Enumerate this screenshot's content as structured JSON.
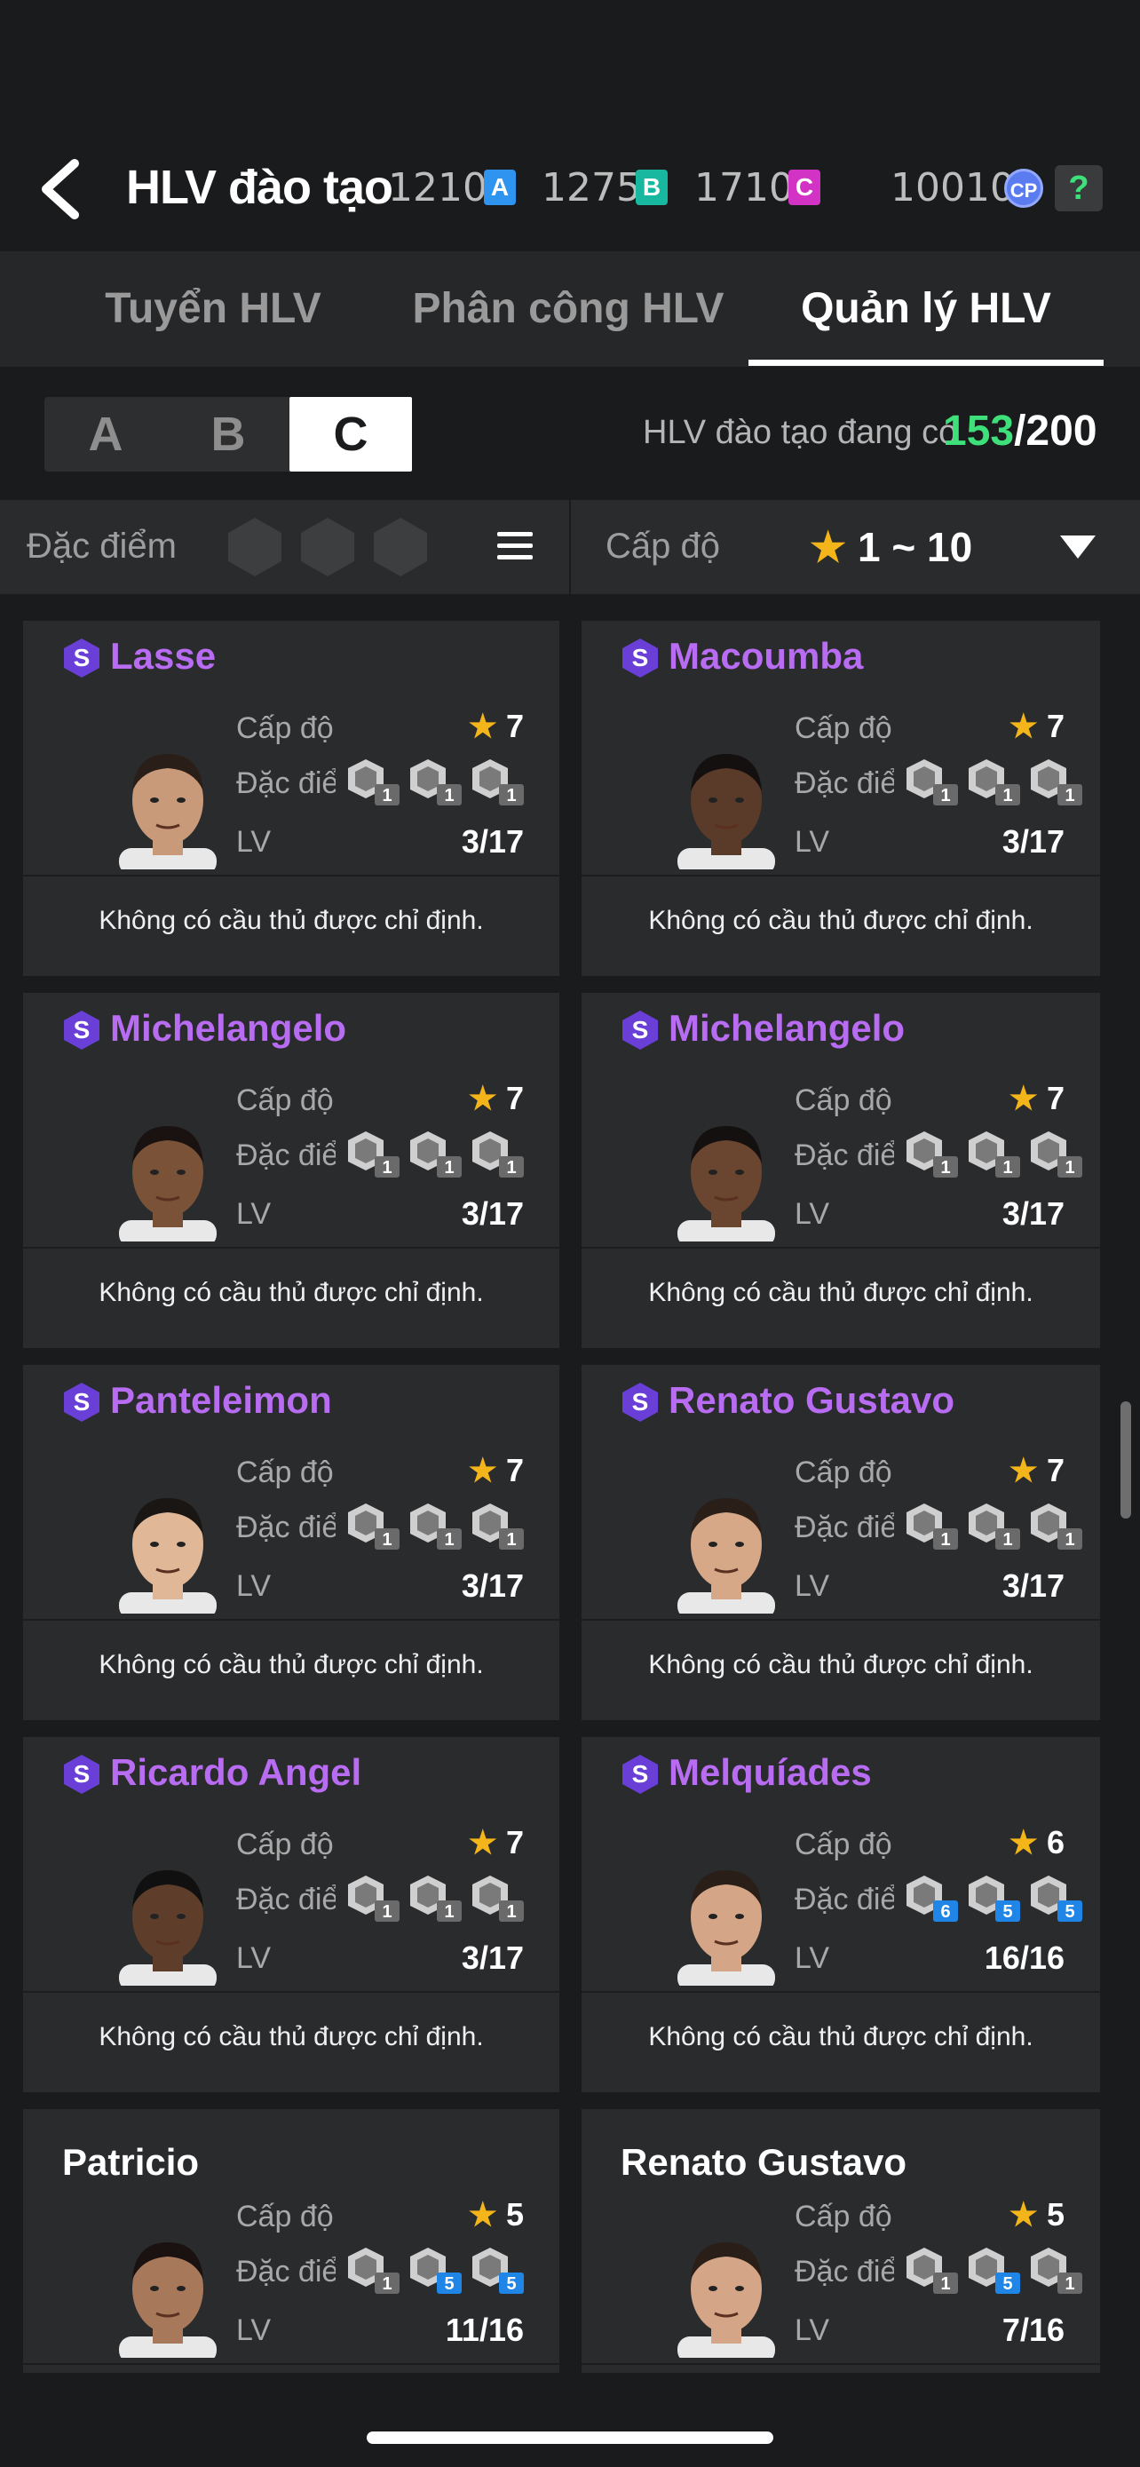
{
  "header": {
    "title": "HLV đào tạo",
    "back_icon": "chevron-left-icon",
    "currencies": [
      {
        "value": "1210",
        "badge": "A",
        "color": "#2f93f0"
      },
      {
        "value": "1275",
        "badge": "B",
        "color": "#18b8a0"
      },
      {
        "value": "1710",
        "badge": "C",
        "color": "#d233c4"
      },
      {
        "value": "10010",
        "badge": "CP",
        "color": "#5b7cf0"
      }
    ],
    "help": "?"
  },
  "tabs": [
    {
      "label": "Tuyển HLV",
      "active": false
    },
    {
      "label": "Phân công  HLV",
      "active": false
    },
    {
      "label": "Quản lý HLV",
      "active": true
    }
  ],
  "grade_filter": {
    "options": [
      "A",
      "B",
      "C"
    ],
    "selected": "C"
  },
  "coach_count": {
    "label": "HLV đào tạo đang có",
    "current": "153",
    "total": "/200"
  },
  "filters": {
    "trait_label": "Đặc điểm c",
    "level_label": "Cấp độ",
    "level_star": "★",
    "level_range": "1 ~ 10"
  },
  "labels": {
    "level": "Cấp độ",
    "traits": "Đặc điểm",
    "lv": "LV"
  },
  "coaches": [
    {
      "name": "Lasse",
      "special": true,
      "level": "7",
      "lv": "3/17",
      "trait_levels": [
        "1",
        "1",
        "1"
      ],
      "trait_blue": [
        false,
        false,
        false
      ],
      "note": "Không có cầu thủ được chỉ định."
    },
    {
      "name": "Macoumba",
      "special": true,
      "level": "7",
      "lv": "3/17",
      "trait_levels": [
        "1",
        "1",
        "1"
      ],
      "trait_blue": [
        false,
        false,
        false
      ],
      "note": "Không có cầu thủ được chỉ định."
    },
    {
      "name": "Michelangelo",
      "special": true,
      "level": "7",
      "lv": "3/17",
      "trait_levels": [
        "1",
        "1",
        "1"
      ],
      "trait_blue": [
        false,
        false,
        false
      ],
      "note": "Không có cầu thủ được chỉ định."
    },
    {
      "name": "Michelangelo",
      "special": true,
      "level": "7",
      "lv": "3/17",
      "trait_levels": [
        "1",
        "1",
        "1"
      ],
      "trait_blue": [
        false,
        false,
        false
      ],
      "note": "Không có cầu thủ được chỉ định."
    },
    {
      "name": "Panteleimon",
      "special": true,
      "level": "7",
      "lv": "3/17",
      "trait_levels": [
        "1",
        "1",
        "1"
      ],
      "trait_blue": [
        false,
        false,
        false
      ],
      "note": "Không có cầu thủ được chỉ định."
    },
    {
      "name": "Renato Gustavo",
      "special": true,
      "level": "7",
      "lv": "3/17",
      "trait_levels": [
        "1",
        "1",
        "1"
      ],
      "trait_blue": [
        false,
        false,
        false
      ],
      "note": "Không có cầu thủ được chỉ định."
    },
    {
      "name": "Ricardo Angel",
      "special": true,
      "level": "7",
      "lv": "3/17",
      "trait_levels": [
        "1",
        "1",
        "1"
      ],
      "trait_blue": [
        false,
        false,
        false
      ],
      "note": "Không có cầu thủ được chỉ định."
    },
    {
      "name": "Melquíades",
      "special": true,
      "level": "6",
      "lv": "16/16",
      "trait_levels": [
        "6",
        "5",
        "5"
      ],
      "trait_blue": [
        true,
        true,
        true
      ],
      "note": "Không có cầu thủ được chỉ định."
    },
    {
      "name": "Patricio",
      "special": false,
      "level": "5",
      "lv": "11/16",
      "trait_levels": [
        "1",
        "5",
        "5"
      ],
      "trait_blue": [
        false,
        true,
        true
      ],
      "note": ""
    },
    {
      "name": "Renato Gustavo",
      "special": false,
      "level": "5",
      "lv": "7/16",
      "trait_levels": [
        "1",
        "5",
        "1"
      ],
      "trait_blue": [
        false,
        true,
        false
      ],
      "note": ""
    }
  ],
  "colors": {
    "special_name": "#b86cf2",
    "star": "#f3b51a",
    "count_green": "#3ee07a"
  }
}
